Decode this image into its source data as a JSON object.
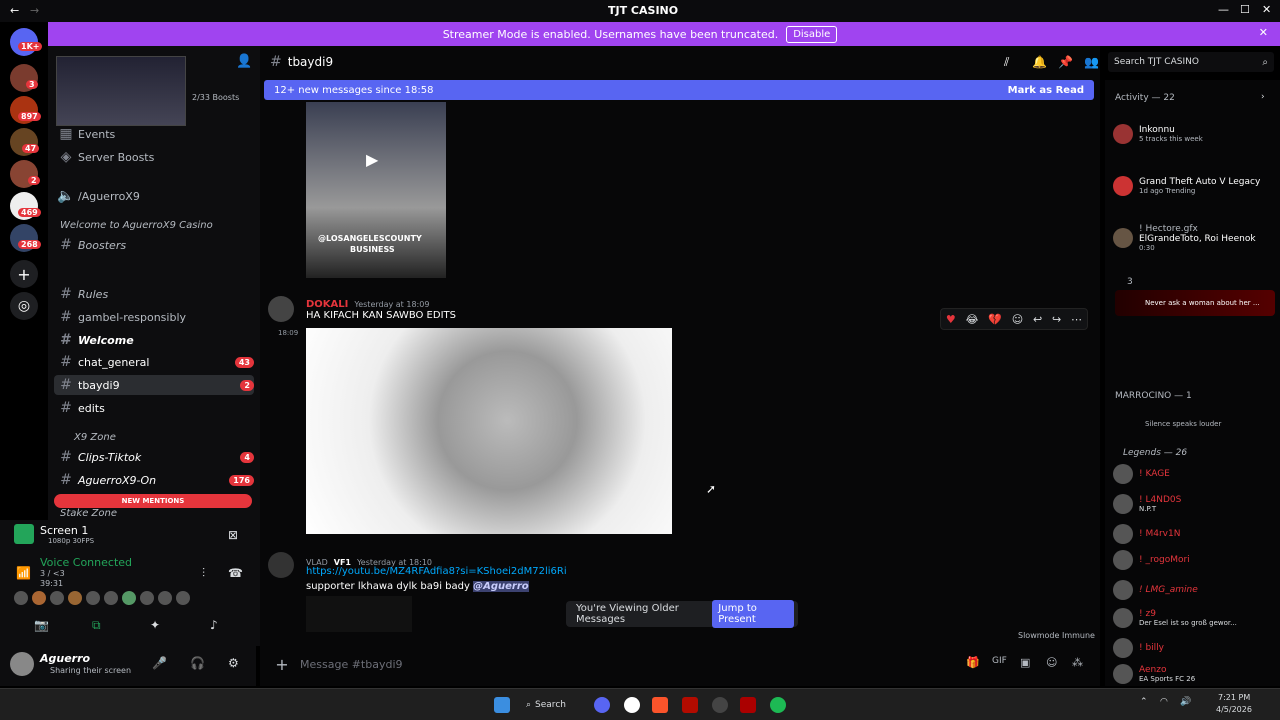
{
  "window": {
    "title": "TJT CASINO"
  },
  "banner": {
    "text": "Streamer Mode is enabled. Usernames have been truncated.",
    "button": "Disable"
  },
  "servers": {
    "badges": [
      "1K+",
      "3",
      "897",
      "47",
      "2",
      "469",
      "268"
    ]
  },
  "sidebar": {
    "boosts": "2/33 Boosts",
    "items": [
      {
        "label": "Events"
      },
      {
        "label": "Server Boosts"
      },
      {
        "label": "/AguerroX9"
      }
    ],
    "categories": [
      "Welcome to AguerroX9 Casino",
      "X9 Zone",
      "Stake Zone"
    ],
    "channels": [
      {
        "label": "Boosters"
      },
      {
        "label": "Rules"
      },
      {
        "label": "gambel-responsibly"
      },
      {
        "label": "Welcome"
      },
      {
        "label": "chat_general",
        "count": "43"
      },
      {
        "label": "tbaydi9",
        "count": "2"
      },
      {
        "label": "edits"
      },
      {
        "label": "Clips-Tiktok",
        "count": "4"
      },
      {
        "label": "AguerroX9-On",
        "count": "176"
      }
    ],
    "new_mentions": "NEW MENTIONS"
  },
  "screen_share": {
    "title": "Screen 1",
    "sub": "1080p 30FPS"
  },
  "voice": {
    "status": "Voice Connected",
    "detail": "3 / <3",
    "time": "39:31"
  },
  "user": {
    "name": "Aguerro",
    "status": "Sharing their screen"
  },
  "channel": {
    "name": "tbaydi9",
    "new_messages": "12+ new messages since 18:58",
    "mark_read": "Mark as Read",
    "search_placeholder": "Search TJT CASINO"
  },
  "video_caption": {
    "line1": "@LOSANGELESCOUNTY",
    "line2": "BUSINESS"
  },
  "messages": [
    {
      "author": "DOKALI",
      "time": "Yesterday at 18:09",
      "side_time": "18:09",
      "text": "HA KIFACH KAN SAWBO EDITS"
    },
    {
      "author": "VLAD",
      "tag": "VF1",
      "time": "Yesterday at 18:10",
      "link": "https://youtu.be/MZ4RFAdfia8?si=KShoei2dM72li6Ri",
      "text": "supporter lkhawa dylk ba9i bady ",
      "mention": "@Aguerro"
    }
  ],
  "older": {
    "text": "You're Viewing Older Messages",
    "button": "Jump to Present"
  },
  "slowmode": "Slowmode Immune",
  "composer": {
    "placeholder": "Message #tbaydi9"
  },
  "members": {
    "activity": "Activity — 22",
    "rows": [
      {
        "name": "Inkonnu",
        "sub": "5 tracks this week"
      },
      {
        "name": "Grand Theft Auto V Legacy",
        "sub": "1d ago  Trending"
      },
      {
        "name": "! Hectore.gfx",
        "sub": ""
      },
      {
        "name": "ElGrandeToto, Roi Heenok",
        "sub": "0:30"
      }
    ],
    "section3": "3",
    "never_ask": "Never ask a woman about her ...",
    "marrocino": "MARROCINO — 1",
    "silence": "Silence speaks louder",
    "legends": "Legends — 26",
    "legend_rows": [
      {
        "name": "! KAGE",
        "sub": ""
      },
      {
        "name": "! L4ND0S",
        "sub": "N.P.T"
      },
      {
        "name": "! M4rv1N",
        "sub": ""
      },
      {
        "name": "! _rogoMori",
        "sub": ""
      },
      {
        "name": "! LMG_amine",
        "sub": ""
      },
      {
        "name": "! z9",
        "sub": "Der Esel ist so groß gewor..."
      },
      {
        "name": "! billy",
        "sub": ""
      },
      {
        "name": "Aenzo",
        "sub": "EA Sports FC 26"
      }
    ]
  },
  "taskbar": {
    "search": "Search",
    "time": "7:21 PM",
    "date": "4/5/2026"
  },
  "colors": {
    "accent": "#5865f2",
    "banner": "#a044f0",
    "badge": "#e5353c"
  }
}
